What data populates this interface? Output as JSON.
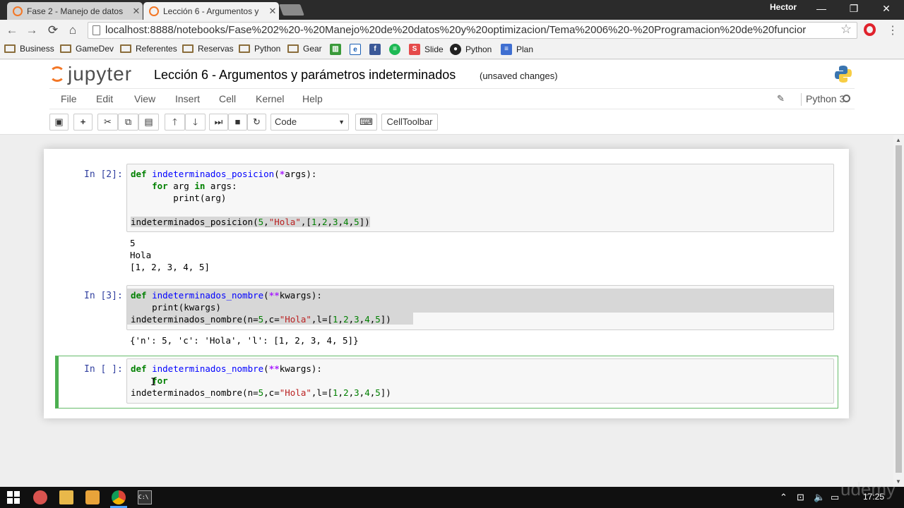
{
  "browser": {
    "tabs": [
      {
        "title": "Fase 2 - Manejo de datos"
      },
      {
        "title": "Lección 6 - Argumentos y"
      }
    ],
    "user": "Hector",
    "url": "localhost:8888/notebooks/Fase%202%20-%20Manejo%20de%20datos%20y%20optimizacion/Tema%2006%20-%20Programacion%20de%20funcior",
    "bookmarks": [
      "Business",
      "GameDev",
      "Referentes",
      "Reservas",
      "Python",
      "Gear",
      "Slide",
      "Python",
      "Plan"
    ]
  },
  "jupyter": {
    "logo_text": "jupyter",
    "notebook_name": "Lección 6 - Argumentos y parámetros indeterminados",
    "status": "(unsaved changes)",
    "menu": [
      "File",
      "Edit",
      "View",
      "Insert",
      "Cell",
      "Kernel",
      "Help"
    ],
    "kernel_name": "Python 3",
    "cell_type": "Code",
    "celltoolbar_label": "CellToolbar"
  },
  "cells": [
    {
      "prompt": "In [2]:",
      "output": [
        "5",
        "Hola",
        "[1, 2, 3, 4, 5]"
      ]
    },
    {
      "prompt": "In [3]:",
      "output": [
        "{'n': 5, 'c': 'Hola', 'l': [1, 2, 3, 4, 5]}"
      ]
    },
    {
      "prompt": "In [ ]:",
      "output": []
    }
  ],
  "taskbar": {
    "clock": "17:25",
    "watermark": "udemy"
  }
}
